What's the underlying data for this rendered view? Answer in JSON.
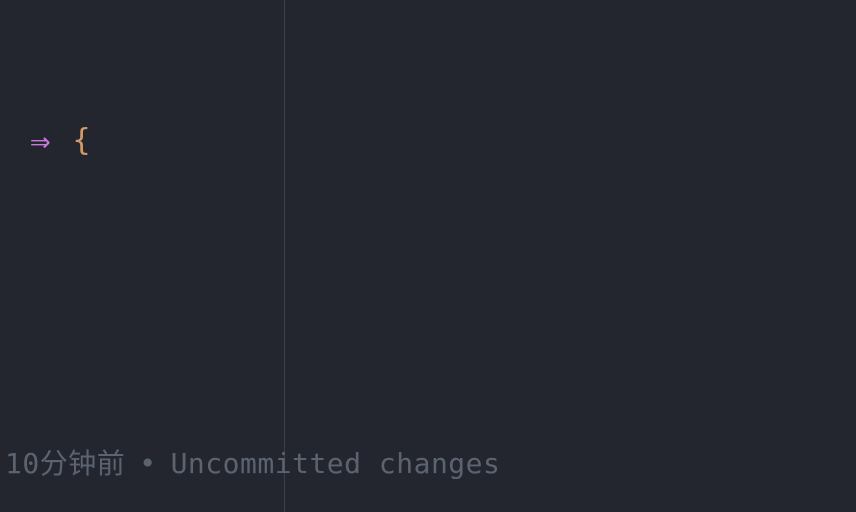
{
  "editor": {
    "code_line": {
      "paren": ")",
      "arrow": "⇒",
      "brace": "{"
    },
    "inline_blame": {
      "time": "10分钟前",
      "separator": "•",
      "message": "Uncommitted changes"
    }
  },
  "colors": {
    "background": "#23262e",
    "paren": "#d19a66",
    "arrow": "#c678dd",
    "blame_text": "#5c6370",
    "ruler": "#3a3f4b"
  }
}
